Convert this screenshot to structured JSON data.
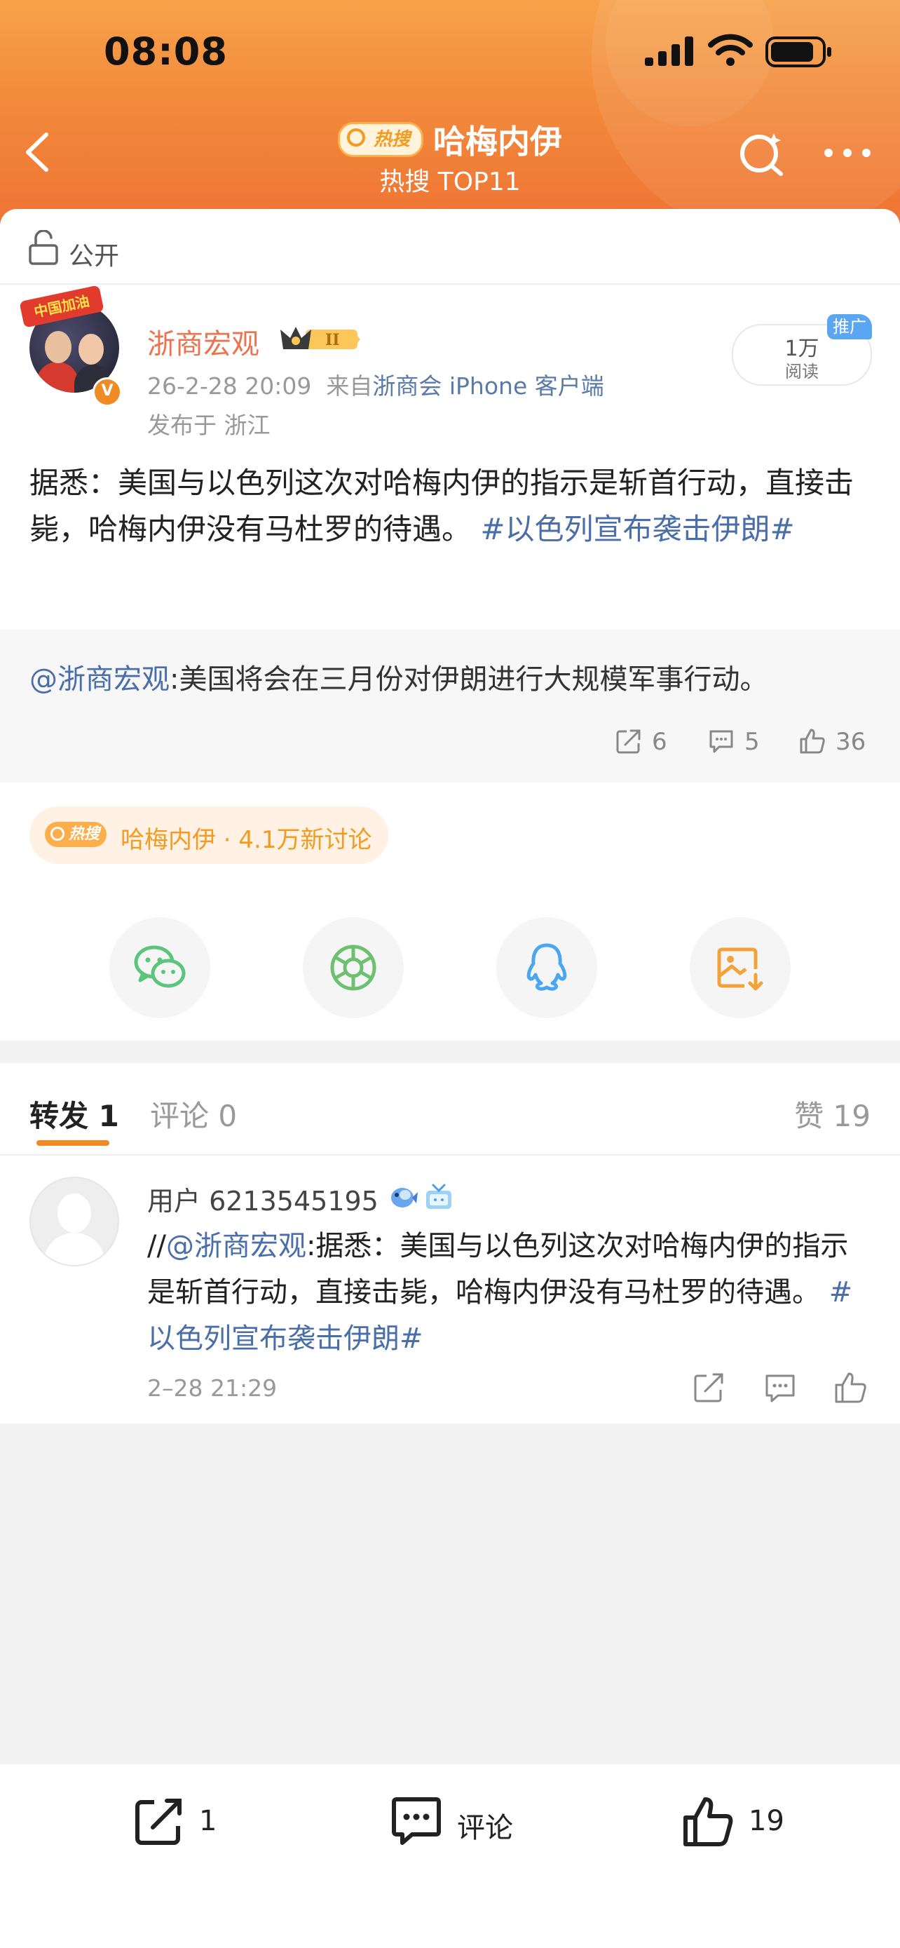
{
  "status_bar": {
    "time": "08:08"
  },
  "header": {
    "hot_badge": "热搜",
    "title": "哈梅内伊",
    "subtitle": "热搜 TOP11"
  },
  "post": {
    "visibility": "公开",
    "author": "浙商宏观",
    "avatar_banner": "中国加油",
    "verified_mark": "V",
    "level_badge": "II",
    "time": "26-2-28 20:09",
    "from_prefix": "来自",
    "source": "浙商会 iPhone 客户端",
    "location": "发布于 浙江",
    "views_count": "1万",
    "views_label": "阅读",
    "promo_tag": "推广",
    "body_text": "据悉：美国与以色列这次对哈梅内伊的指示是斩首行动，直接击毙，哈梅内伊没有马杜罗的待遇。 ",
    "body_topic": "#以色列宣布袭击伊朗#"
  },
  "quoted": {
    "mention": "@浙商宏观",
    "text": ":美国将会在三月份对伊朗进行大规模军事行动。",
    "reposts": "6",
    "comments": "5",
    "likes": "36"
  },
  "hot_topic": {
    "badge": "热搜",
    "text": "哈梅内伊 · 4.1万新讨论"
  },
  "share_targets": [
    {
      "icon": "wechat-icon"
    },
    {
      "icon": "moments-icon"
    },
    {
      "icon": "qq-icon"
    },
    {
      "icon": "save-image-icon"
    }
  ],
  "tabs": {
    "repost_label": "转发",
    "repost_count": "1",
    "comment_label": "评论",
    "comment_count": "0",
    "like_label": "赞 19"
  },
  "repost_item": {
    "user": "用户 6213545195",
    "prefix": "//",
    "mention": "@浙商宏观",
    "text": ":据悉：美国与以色列这次对哈梅内伊的指示是斩首行动，直接击毙，哈梅内伊没有马杜罗的待遇。 ",
    "topic": "#以色列宣布袭击伊朗#",
    "time": "2–28 21:29"
  },
  "bottom_bar": {
    "repost_count": "1",
    "comment_label": "评论",
    "like_count": "19"
  },
  "colors": {
    "header_orange": "#ef7434",
    "link_blue": "#4a6ea9",
    "author_orange": "#eb7350",
    "hot_orange": "#f39a20"
  }
}
